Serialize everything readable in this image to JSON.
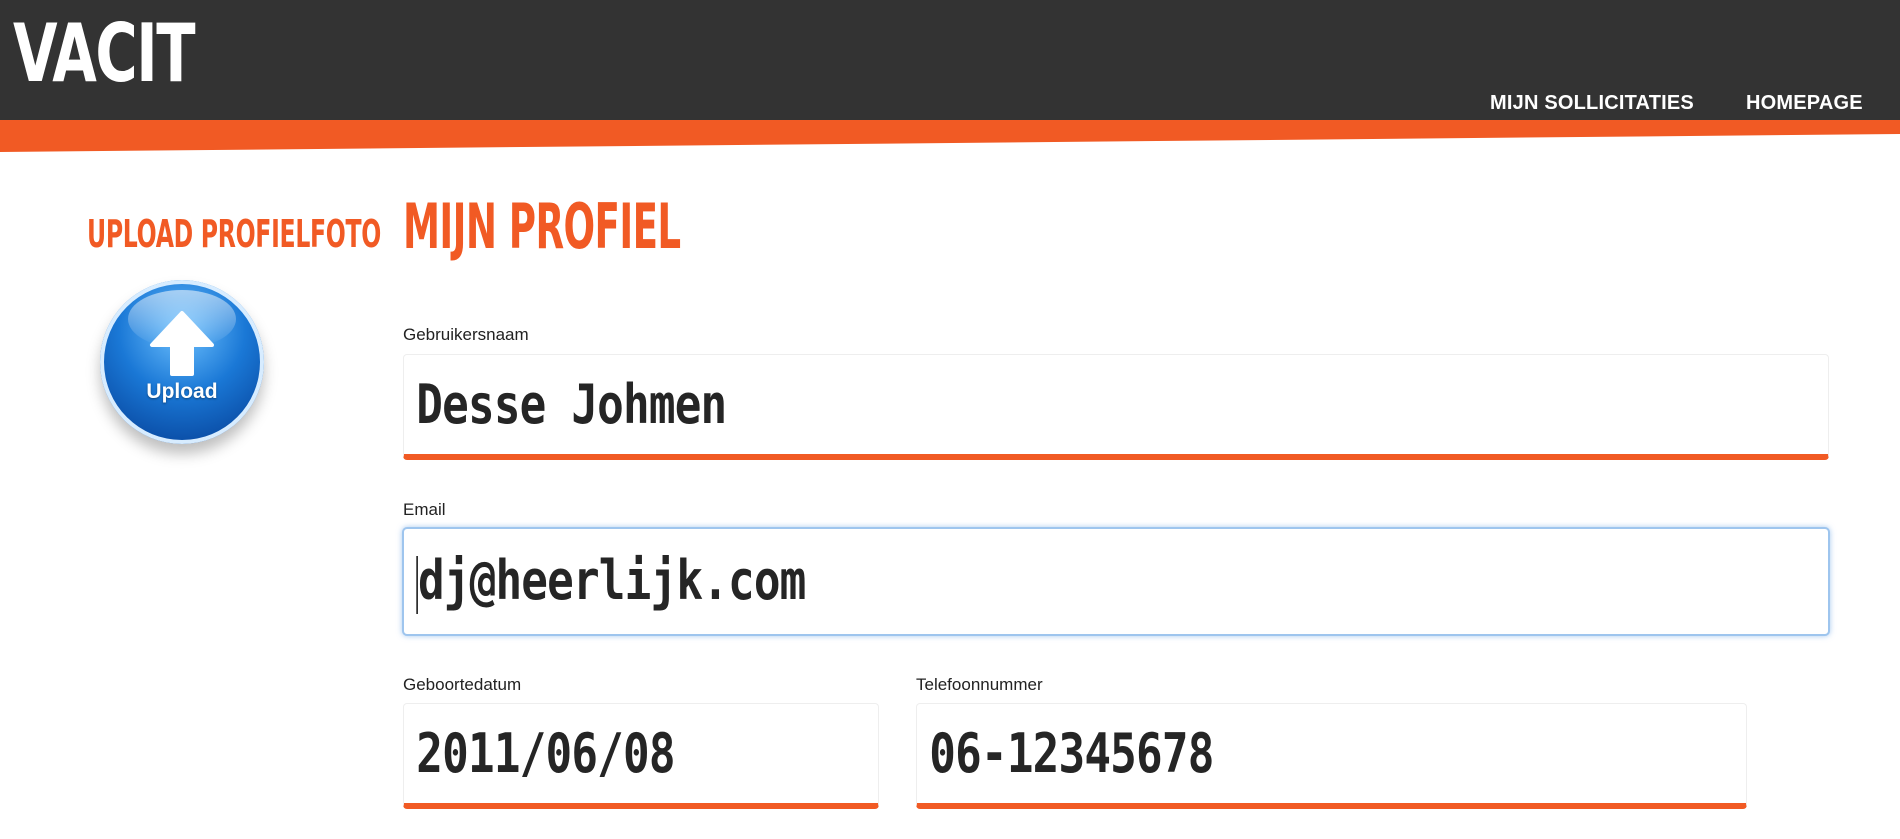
{
  "header": {
    "logo": "VACIT",
    "nav": [
      {
        "label": "MIJN SOLLICITATIES"
      },
      {
        "label": "HOMEPAGE"
      }
    ]
  },
  "sidebar": {
    "upload_title": "UPLOAD PROFIELFOTO",
    "upload_button_label": "Upload",
    "upload_icon": "upload-arrow-icon"
  },
  "profile": {
    "title": "MIJN PROFIEL",
    "fields": {
      "username": {
        "label": "Gebruikersnaam",
        "value": "Desse Johmen"
      },
      "email": {
        "label": "Email",
        "value": "dj@heerlijk.com",
        "focused": true
      },
      "birthdate": {
        "label": "Geboortedatum",
        "value": "2011/06/08"
      },
      "phone": {
        "label": "Telefoonnummer",
        "value": "06-12345678"
      }
    }
  },
  "colors": {
    "accent": "#f15a24",
    "header_bg": "#333333",
    "text": "#252525",
    "focus_border": "#9ec5ee"
  }
}
